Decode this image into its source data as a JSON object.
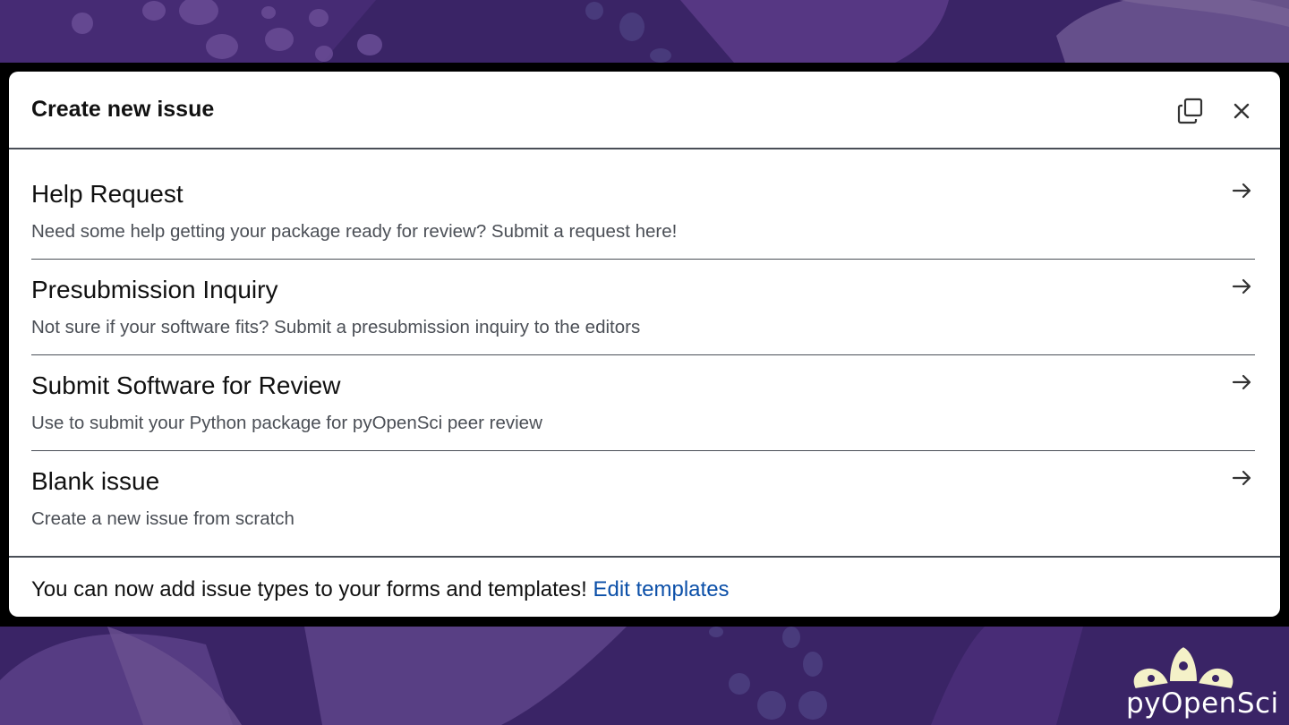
{
  "dialog": {
    "title": "Create new issue",
    "copy_icon": "copy-icon",
    "close_icon": "close-icon"
  },
  "templates": [
    {
      "title": "Help Request",
      "description": "Need some help getting your package ready for review? Submit a request here!"
    },
    {
      "title": "Presubmission Inquiry",
      "description": "Not sure if your software fits? Submit a presubmission inquiry to the editors"
    },
    {
      "title": "Submit Software for Review",
      "description": "Use to submit your Python package for pyOpenSci peer review"
    },
    {
      "title": "Blank issue",
      "description": "Create a new issue from scratch"
    }
  ],
  "footer": {
    "text": "You can now add issue types to your forms and templates! ",
    "link": "Edit templates"
  },
  "logo": {
    "text": "pyOpenSci"
  },
  "colors": {
    "background": "#3a2466",
    "link": "#0b4fa8",
    "divider": "#4a4f57"
  }
}
